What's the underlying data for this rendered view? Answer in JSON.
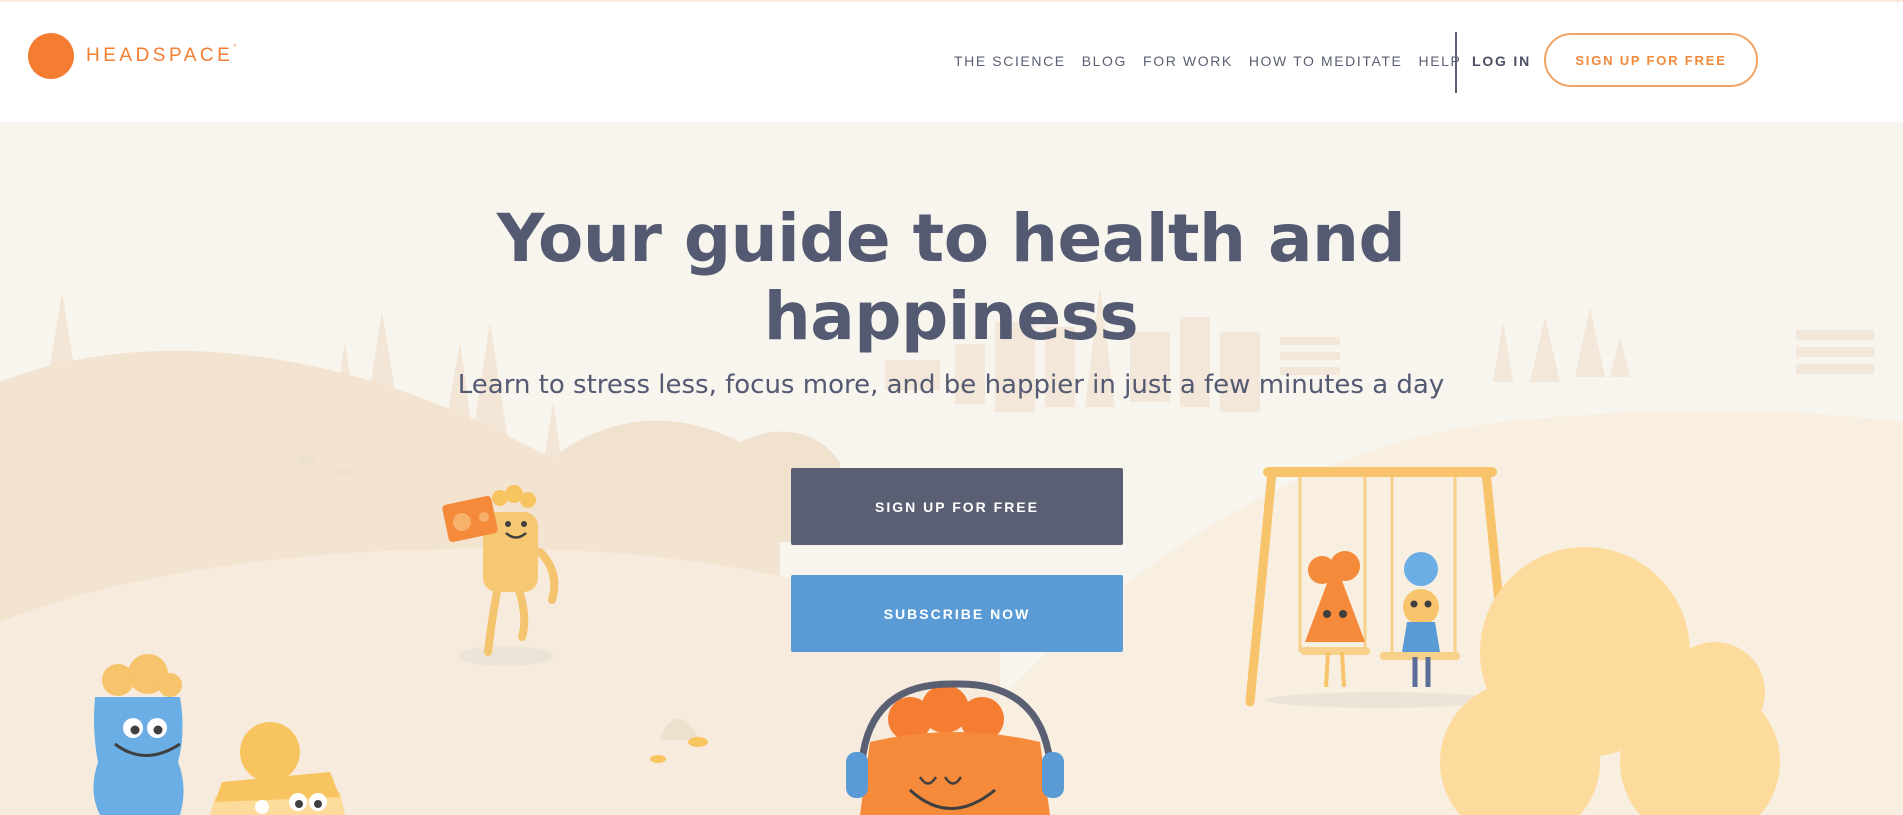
{
  "brand": {
    "name": "HEADSPACE",
    "trademark": "°",
    "color": "#f47d31"
  },
  "nav": {
    "items": [
      {
        "label": "THE SCIENCE"
      },
      {
        "label": "BLOG"
      },
      {
        "label": "FOR WORK"
      },
      {
        "label": "HOW TO MEDITATE"
      },
      {
        "label": "HELP"
      }
    ],
    "login_label": "LOG IN",
    "signup_label": "SIGN UP FOR FREE"
  },
  "hero": {
    "title_line1": "Your guide to health and",
    "title_line2": "happiness",
    "subtitle": "Learn to stress less, focus more, and be happier in just a few minutes a day",
    "primary_button": "SIGN UP FOR FREE",
    "secondary_button": "SUBSCRIBE NOW"
  },
  "colors": {
    "text_dark": "#535a71",
    "primary_button_bg": "#5a5f73",
    "secondary_button_bg": "#5a9bd5",
    "hero_bg": "#f8f4ee",
    "accent_orange": "#f47d31"
  },
  "illustration": {
    "icons": [
      "boombox-icon",
      "headphones-icon",
      "swing-icon"
    ]
  }
}
